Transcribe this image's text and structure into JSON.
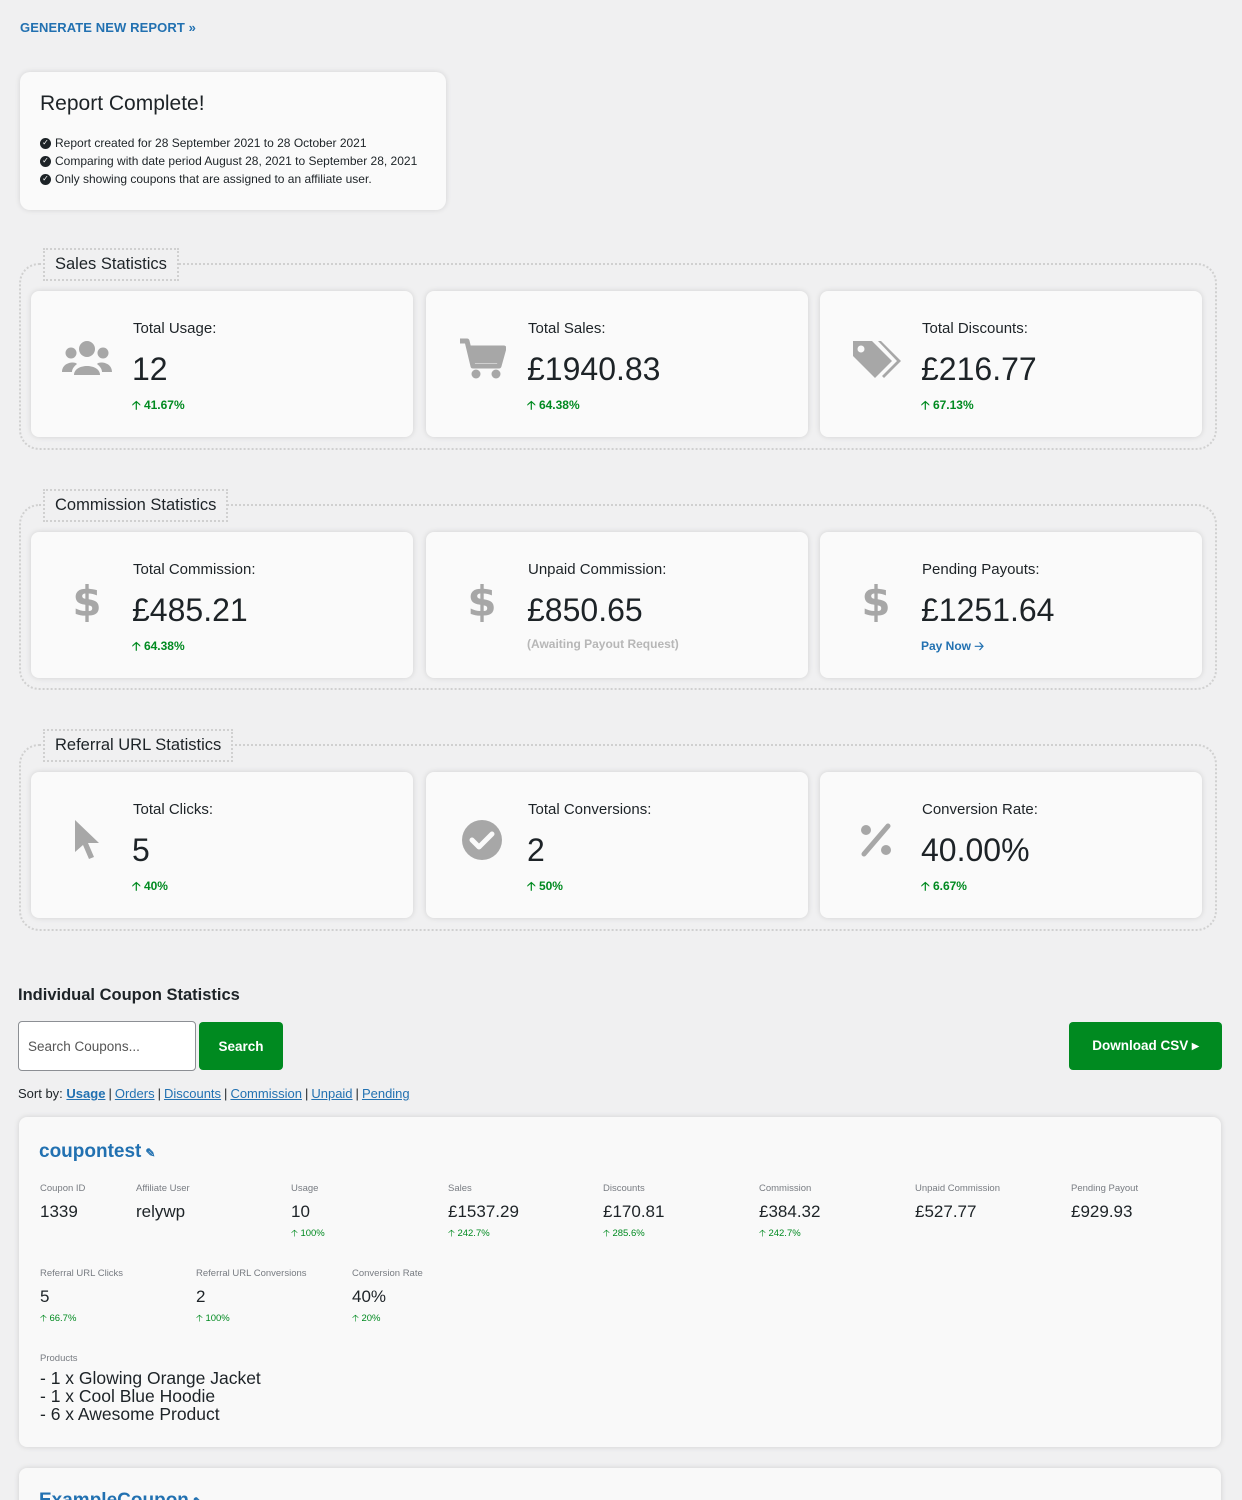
{
  "header": {
    "generate_link": "GENERATE NEW REPORT »"
  },
  "report": {
    "title": "Report Complete!",
    "lines": [
      "Report created for 28 September 2021 to 28 October 2021",
      "Comparing with date period August 28, 2021 to September 28, 2021",
      "Only showing coupons that are assigned to an affiliate user."
    ]
  },
  "sales": {
    "legend": "Sales Statistics",
    "cards": [
      {
        "icon": "users-icon",
        "label": "Total Usage:",
        "value": "12",
        "change": "🡡 41.67%"
      },
      {
        "icon": "cart-icon",
        "label": "Total Sales:",
        "value": "£1940.83",
        "change": "🡡 64.38%"
      },
      {
        "icon": "tags-icon",
        "label": "Total Discounts:",
        "value": "£216.77",
        "change": "🡡 67.13%"
      }
    ]
  },
  "commission": {
    "legend": "Commission Statistics",
    "cards": [
      {
        "icon": "dollar-icon",
        "label": "Total Commission:",
        "value": "£485.21",
        "change": "🡡 64.38%"
      },
      {
        "icon": "dollar-icon",
        "label": "Unpaid Commission:",
        "value": "£850.65",
        "note": "(Awaiting Payout Request)"
      },
      {
        "icon": "dollar-icon",
        "label": "Pending Payouts:",
        "value": "£1251.64",
        "link": "Pay Now 🡢"
      }
    ]
  },
  "referral": {
    "legend": "Referral URL Statistics",
    "cards": [
      {
        "icon": "pointer-icon",
        "label": "Total Clicks:",
        "value": "5",
        "change": "🡡 40%"
      },
      {
        "icon": "check-circle-icon",
        "label": "Total Conversions:",
        "value": "2",
        "change": "🡡 50%"
      },
      {
        "icon": "percent-icon",
        "label": "Conversion Rate:",
        "value": "40.00%",
        "change": "🡡 6.67%"
      }
    ]
  },
  "individual": {
    "title": "Individual Coupon Statistics",
    "search_placeholder": "Search Coupons...",
    "search_button": "Search",
    "csv_button": "Download CSV ▸",
    "sort_label": "Sort by:",
    "sort_options": [
      "Usage",
      "Orders",
      "Discounts",
      "Commission",
      "Unpaid",
      "Pending"
    ]
  },
  "coupons": [
    {
      "name": "coupontest",
      "fields": [
        {
          "label": "Coupon ID",
          "value": "1339"
        },
        {
          "label": "Affiliate User",
          "value": "relywp"
        },
        {
          "label": "Usage",
          "value": "10",
          "change": "🡡 100%"
        },
        {
          "label": "Sales",
          "value": "£1537.29",
          "change": "🡡 242.7%"
        },
        {
          "label": "Discounts",
          "value": "£170.81",
          "change": "🡡 285.6%"
        },
        {
          "label": "Commission",
          "value": "£384.32",
          "change": "🡡 242.7%"
        },
        {
          "label": "Unpaid Commission",
          "value": "£527.77"
        },
        {
          "label": "Pending Payout",
          "value": "£929.93"
        }
      ],
      "fields2": [
        {
          "label": "Referral URL Clicks",
          "value": "5",
          "change": "🡡 66.7%"
        },
        {
          "label": "Referral URL Conversions",
          "value": "2",
          "change": "🡡 100%"
        },
        {
          "label": "Conversion Rate",
          "value": "40%",
          "change": "🡡 20%"
        }
      ],
      "products_label": "Products",
      "products": [
        "- 1 x Glowing Orange Jacket",
        "- 1 x Cool Blue Hoodie",
        "- 6 x Awesome Product"
      ]
    },
    {
      "name": "ExampleCoupon"
    }
  ],
  "colors": {
    "accent": "#2271b1",
    "green": "#008a20",
    "icon_gray": "#a7a7a7",
    "bg": "#f0f0f1"
  }
}
